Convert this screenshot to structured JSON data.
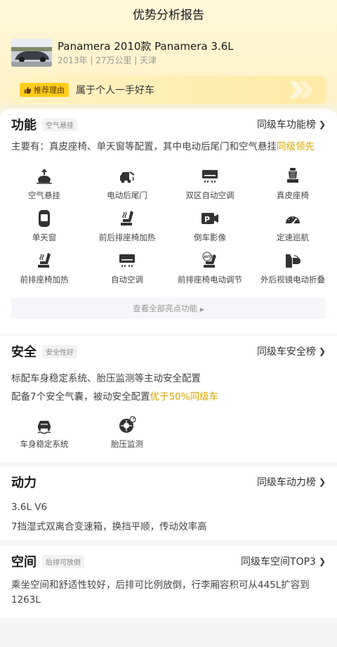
{
  "header": {
    "title": "优势分析报告"
  },
  "car": {
    "title": "Panamera 2010款 Panamera 3.6L",
    "meta": "2013年 | 27万公里 | 天津"
  },
  "reason": {
    "badge": "推荐理由",
    "text": "属于个人一手好车"
  },
  "function": {
    "title": "功能",
    "tag": "空气悬挂",
    "rank": "同级车功能榜",
    "desc_prefix": "主要有：真皮座椅、单天窗等配置，其中电动后尾门和空气悬挂",
    "desc_highlight": "同级领先",
    "items": [
      {
        "label": "空气悬挂",
        "icon": "air-suspension-icon"
      },
      {
        "label": "电动后尾门",
        "icon": "power-tailgate-icon"
      },
      {
        "label": "双区自动空调",
        "icon": "dual-zone-ac-icon"
      },
      {
        "label": "真皮座椅",
        "icon": "leather-seat-icon"
      },
      {
        "label": "单天窗",
        "icon": "sunroof-icon"
      },
      {
        "label": "前后排座椅加热",
        "icon": "seat-heating-icon"
      },
      {
        "label": "倒车影像",
        "icon": "reverse-camera-icon"
      },
      {
        "label": "定速巡航",
        "icon": "cruise-control-icon"
      },
      {
        "label": "前排座椅加热",
        "icon": "front-seat-heating-icon"
      },
      {
        "label": "自动空调",
        "icon": "auto-ac-icon"
      },
      {
        "label": "前排座椅电动调节",
        "icon": "power-seat-icon"
      },
      {
        "label": "外后视镜电动折叠",
        "icon": "mirror-fold-icon"
      }
    ],
    "more": "查看全部亮点功能"
  },
  "safety": {
    "title": "安全",
    "tag": "安全性好",
    "rank": "同级车安全榜",
    "line1": "标配车身稳定系统、胎压监测等主动安全配置",
    "line2_prefix": "配备7个安全气囊，被动安全配置",
    "line2_highlight": "优于50%同级车",
    "items": [
      {
        "label": "车身稳定系统",
        "icon": "stability-control-icon"
      },
      {
        "label": "胎压监测",
        "icon": "tire-pressure-icon"
      }
    ]
  },
  "power": {
    "title": "动力",
    "rank": "同级车动力榜",
    "engine": "3.6L V6",
    "gearbox": "7挡湿式双离合变速箱，换挡平顺，传动效率高"
  },
  "space": {
    "title": "空间",
    "tag": "后排可放倒",
    "rank": "同级车空间TOP3",
    "desc": "乘坐空间和舒适性较好，后排可比例放倒，行李厢容积可从445L扩容到1263L"
  },
  "colors": {
    "highlight": "#d9a400",
    "badge": "#ffcc1a",
    "icon": "#333333"
  }
}
